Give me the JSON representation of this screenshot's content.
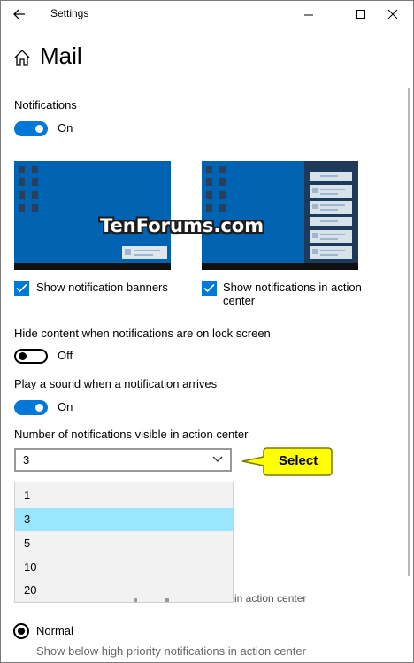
{
  "window": {
    "title": "Settings"
  },
  "page": {
    "title": "Mail"
  },
  "notifications": {
    "label": "Notifications",
    "toggle_text": "On"
  },
  "watermark": "TenForums.com",
  "banners": {
    "label": "Show notification banners"
  },
  "action_center": {
    "label_line1": "Show notifications in action",
    "label_line2": "center"
  },
  "hide_content": {
    "label": "Hide content when notifications are on lock screen",
    "toggle_text": "Off"
  },
  "sound": {
    "label": "Play a sound when a notification arrives",
    "toggle_text": "On"
  },
  "visible_count": {
    "label": "Number of notifications visible in action center",
    "value": "3",
    "options": [
      "1",
      "3",
      "5",
      "10",
      "20"
    ],
    "selected_index": 1
  },
  "callout": {
    "text": "Select"
  },
  "behind_text": "in action center",
  "priority": {
    "option_label": "Normal",
    "option_desc": "Show below high priority notifications in action center"
  },
  "colors": {
    "accent": "#0078d7",
    "highlight": "#9be6ff",
    "callout": "#ffff00"
  }
}
